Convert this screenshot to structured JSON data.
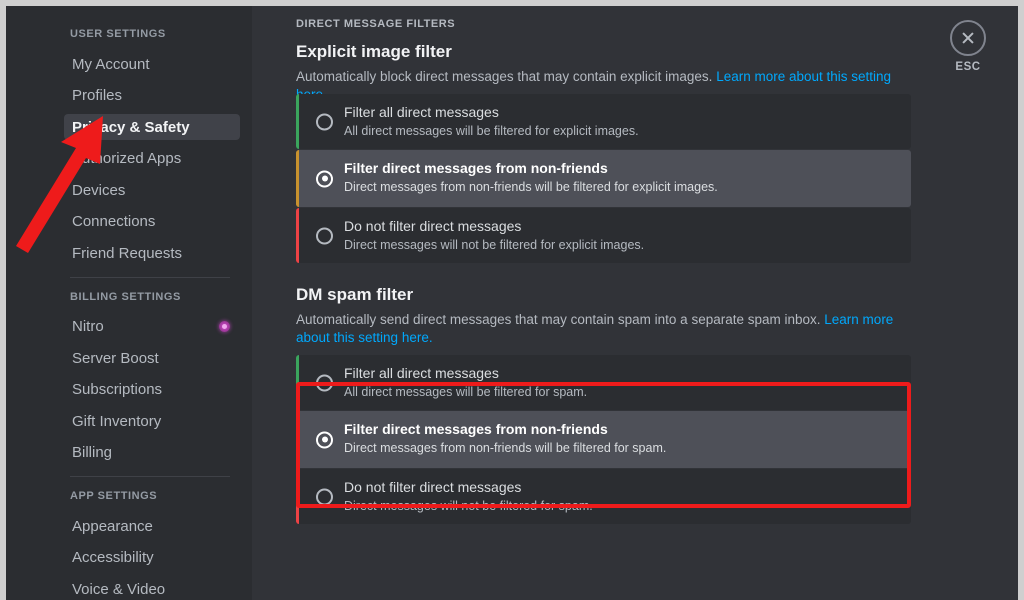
{
  "window": {
    "frame_color": "#cfcfcf",
    "bg": "#2b2d31"
  },
  "sidebar": {
    "groups": [
      {
        "label": "USER SETTINGS",
        "items": [
          {
            "label": "My Account",
            "active": false
          },
          {
            "label": "Profiles",
            "active": false
          },
          {
            "label": "Privacy & Safety",
            "active": true
          },
          {
            "label": "Authorized Apps",
            "active": false
          },
          {
            "label": "Devices",
            "active": false
          },
          {
            "label": "Connections",
            "active": false
          },
          {
            "label": "Friend Requests",
            "active": false
          }
        ]
      },
      {
        "label": "BILLING SETTINGS",
        "items": [
          {
            "label": "Nitro",
            "active": false,
            "badge": "nitro-badge"
          },
          {
            "label": "Server Boost",
            "active": false
          },
          {
            "label": "Subscriptions",
            "active": false
          },
          {
            "label": "Gift Inventory",
            "active": false
          },
          {
            "label": "Billing",
            "active": false
          }
        ]
      },
      {
        "label": "APP SETTINGS",
        "items": [
          {
            "label": "Appearance",
            "active": false
          },
          {
            "label": "Accessibility",
            "active": false
          },
          {
            "label": "Voice & Video",
            "active": false
          }
        ]
      }
    ]
  },
  "main": {
    "kicker": "DIRECT MESSAGE FILTERS",
    "close": {
      "icon": "close-icon",
      "label": "ESC"
    },
    "sections": [
      {
        "title": "Explicit image filter",
        "desc_text": "Automatically block direct messages that may contain explicit images. ",
        "desc_link": "Learn more about this setting here.",
        "options": [
          {
            "title": "Filter all direct messages",
            "subtitle": "All direct messages will be filtered for explicit images.",
            "selected": false,
            "accent": "#3ba55d"
          },
          {
            "title": "Filter direct messages from non-friends",
            "subtitle": "Direct messages from non-friends will be filtered for explicit images.",
            "selected": true,
            "accent": "#c8922e"
          },
          {
            "title": "Do not filter direct messages",
            "subtitle": "Direct messages will not be filtered for explicit images.",
            "selected": false,
            "accent": "#ed4245"
          }
        ]
      },
      {
        "title": "DM spam filter",
        "desc_text": "Automatically send direct messages that may contain spam into a separate spam inbox. ",
        "desc_link": "Learn more about this setting here.",
        "options": [
          {
            "title": "Filter all direct messages",
            "subtitle": "All direct messages will be filtered for spam.",
            "selected": false,
            "accent": "#3ba55d"
          },
          {
            "title": "Filter direct messages from non-friends",
            "subtitle": "Direct messages from non-friends will be filtered for spam.",
            "selected": true,
            "accent": "#c8922e"
          },
          {
            "title": "Do not filter direct messages",
            "subtitle": "Direct messages will not be filtered for spam.",
            "selected": false,
            "accent": "#ed4245"
          }
        ]
      }
    ]
  },
  "annotations": {
    "color": "#ee1b1b",
    "arrow": {
      "name": "red-arrow-pointing-to-privacy-and-safety"
    },
    "highlight_box": {
      "name": "red-highlight-box-around-dm-spam-filter-options"
    }
  }
}
